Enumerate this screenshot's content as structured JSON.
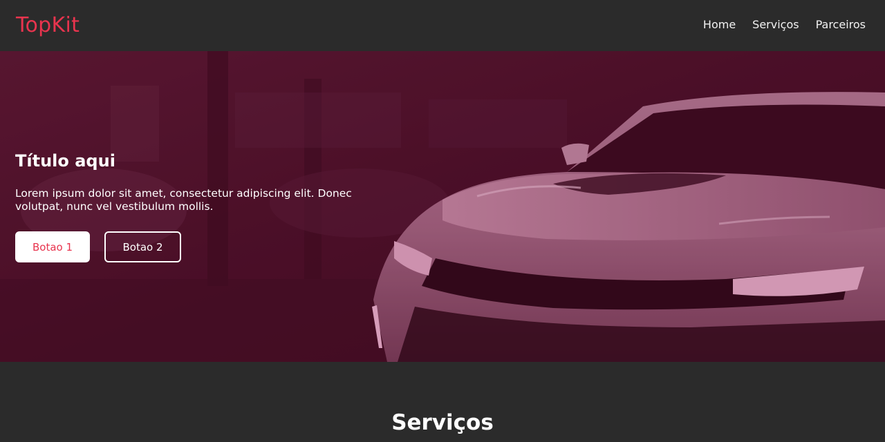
{
  "brand": {
    "name": "TopKit",
    "color": "#e8344e"
  },
  "nav": {
    "items": [
      {
        "label": "Home"
      },
      {
        "label": "Serviços"
      },
      {
        "label": "Parceiros"
      }
    ]
  },
  "hero": {
    "title": "Título aqui",
    "text": "Lorem ipsum dolor sit amet, consectetur adipiscing elit. Donec volutpat, nunc vel vestibulum mollis.",
    "button1": "Botao 1",
    "button2": "Botao 2",
    "overlay_color": "#4a0f27"
  },
  "services": {
    "title": "Serviços"
  }
}
